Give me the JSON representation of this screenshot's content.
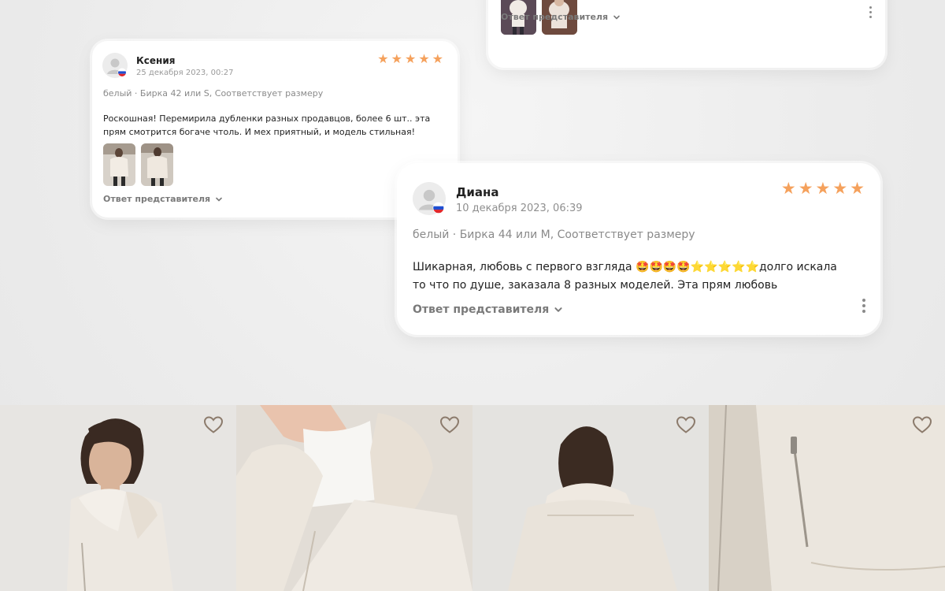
{
  "review_top": {
    "reply_label": "Ответ представителя"
  },
  "review_1": {
    "author": "Ксения",
    "date": "25 декабря 2023, 00:27",
    "rating": 5,
    "meta": "белый · Бирка 42 или S, Соответствует размеру",
    "text": "Роскошная! Перемирила дубленки разных продавцов, более 6 шт.. эта прям смотрится богаче чтоль. И мех приятный, и модель стильная!",
    "reply_label": "Ответ представителя"
  },
  "review_2": {
    "author": "Диана",
    "date": "10 декабря 2023, 06:39",
    "rating": 5,
    "meta": "белый · Бирка 44 или М, Соответствует размеру",
    "text_start": "Шикарная, любовь с первого взгляда ",
    "emojis": "🤩🤩🤩🤩⭐⭐⭐⭐⭐",
    "text_end": "долго искала то что по душе, заказала 8 разных моделей. Эта прям любовь",
    "reply_label": "Ответ представителя"
  },
  "colors": {
    "star": "#f5a15c",
    "reply_text": "#7a7a7a",
    "meta_text": "#8a8a8a",
    "heart": "#8c7b6c"
  },
  "icons": {
    "star": "★",
    "heart": "heart-outline-icon",
    "chevron": "chevron-down-icon",
    "more": "kebab-menu-icon"
  },
  "gallery_count": 4
}
